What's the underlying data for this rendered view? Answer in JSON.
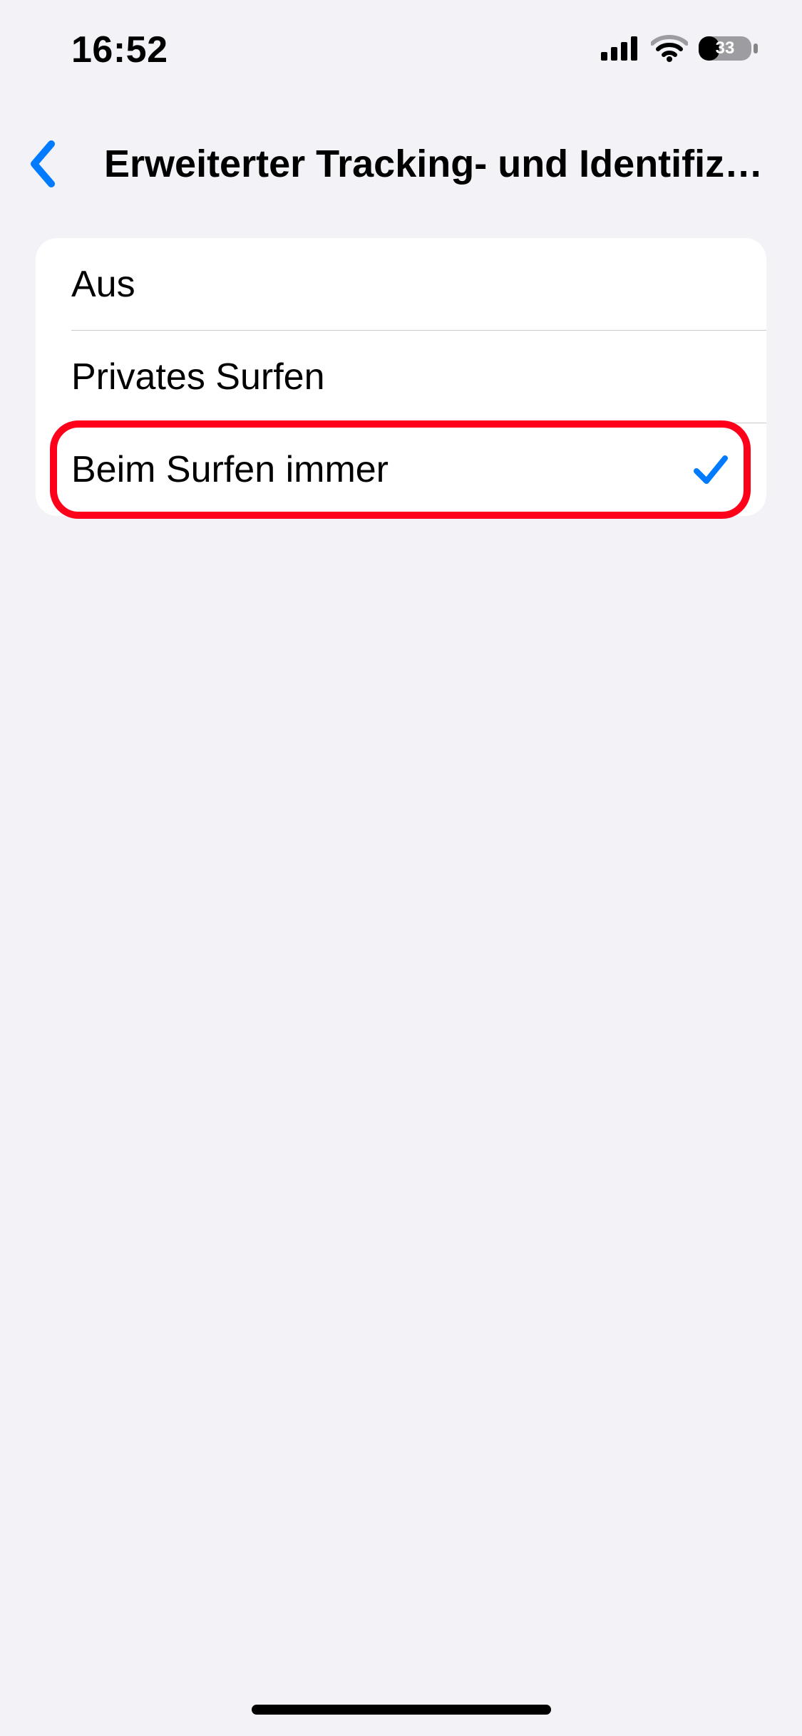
{
  "status_bar": {
    "time": "16:52",
    "battery_percent": "33"
  },
  "nav": {
    "title": "Erweiterter Tracking- und Identifizier…"
  },
  "options": [
    {
      "label": "Aus",
      "selected": false
    },
    {
      "label": "Privates Surfen",
      "selected": false
    },
    {
      "label": "Beim Surfen immer",
      "selected": true
    }
  ]
}
